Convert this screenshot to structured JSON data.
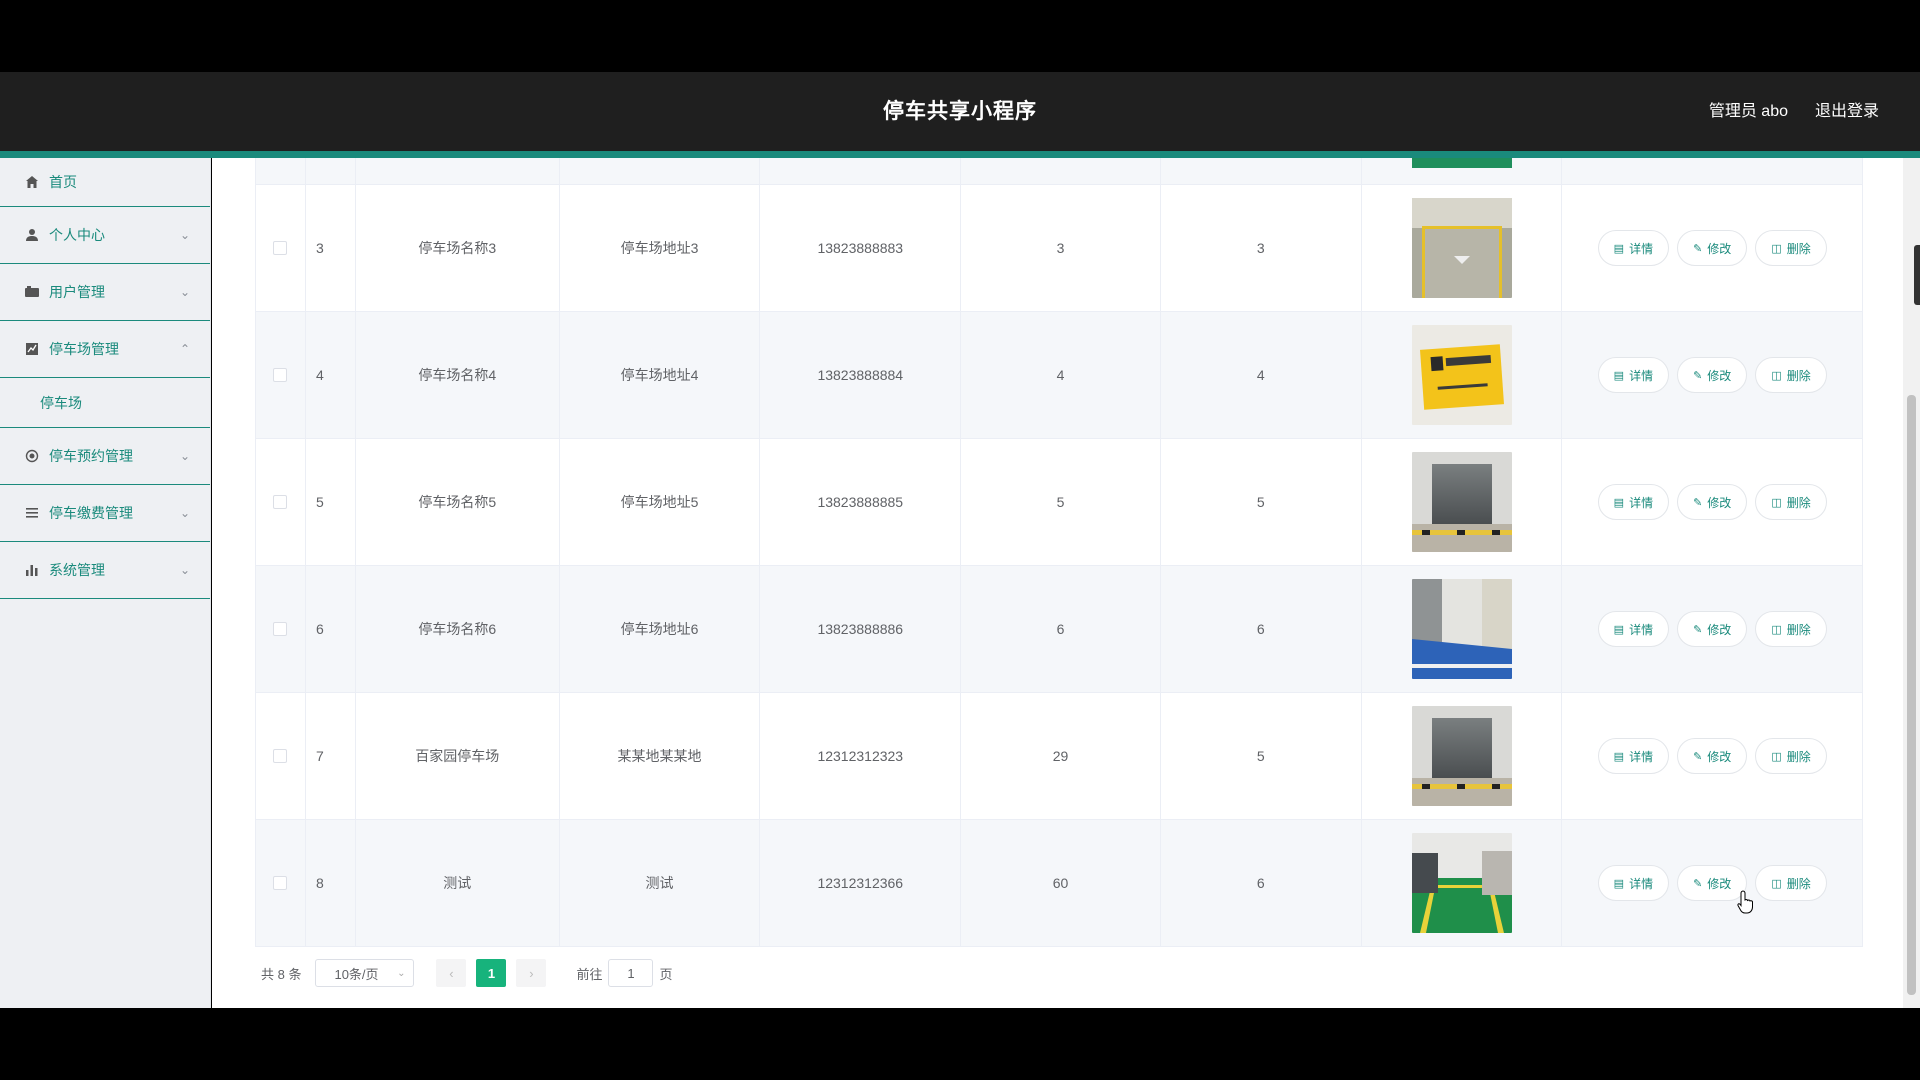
{
  "app": {
    "title": "停车共享小程序",
    "user_label": "管理员 abo",
    "logout_label": "退出登录"
  },
  "sidebar": {
    "items": [
      {
        "label": "首页",
        "icon": "home-icon",
        "expandable": false
      },
      {
        "label": "个人中心",
        "icon": "user-icon",
        "expandable": true
      },
      {
        "label": "用户管理",
        "icon": "users-icon",
        "expandable": true
      },
      {
        "label": "停车场管理",
        "icon": "chart-icon",
        "expandable": true,
        "expanded": true,
        "children": [
          "停车场"
        ]
      },
      {
        "label": "停车预约管理",
        "icon": "circle-icon",
        "expandable": true
      },
      {
        "label": "停车缴费管理",
        "icon": "list-icon",
        "expandable": true
      },
      {
        "label": "系统管理",
        "icon": "bar-icon",
        "expandable": true
      }
    ]
  },
  "table": {
    "rows": [
      {
        "index": "3",
        "name": "停车场名称3",
        "address": "停车场地址3",
        "phone": "13823888883",
        "n1": "3",
        "n2": "3",
        "image": "parking-lot-photo"
      },
      {
        "index": "4",
        "name": "停车场名称4",
        "address": "停车场地址4",
        "phone": "13823888884",
        "n1": "4",
        "n2": "4",
        "image": "reserved-space-sign-photo"
      },
      {
        "index": "5",
        "name": "停车场名称5",
        "address": "停车场地址5",
        "phone": "13823888885",
        "n1": "5",
        "n2": "5",
        "image": "garage-entrance-photo"
      },
      {
        "index": "6",
        "name": "停车场名称6",
        "address": "停车场地址6",
        "phone": "13823888886",
        "n1": "6",
        "n2": "6",
        "image": "blue-floor-garage-photo"
      },
      {
        "index": "7",
        "name": "百家园停车场",
        "address": "某某地某某地",
        "phone": "12312312323",
        "n1": "29",
        "n2": "5",
        "image": "garage-entrance-photo"
      },
      {
        "index": "8",
        "name": "测试",
        "address": "测试",
        "phone": "12312312366",
        "n1": "60",
        "n2": "6",
        "image": "green-space-car-photo"
      }
    ],
    "actions": {
      "detail": "详情",
      "edit": "修改",
      "delete": "删除"
    }
  },
  "pagination": {
    "total": "共 8 条",
    "page_size": "10条/页",
    "current_page": "1",
    "goto_label": "前往",
    "goto_value": "1",
    "page_suffix": "页"
  },
  "colors": {
    "accent": "#1a8a7c",
    "header_bg": "#1f1f1f",
    "active_page": "#17b37c"
  }
}
